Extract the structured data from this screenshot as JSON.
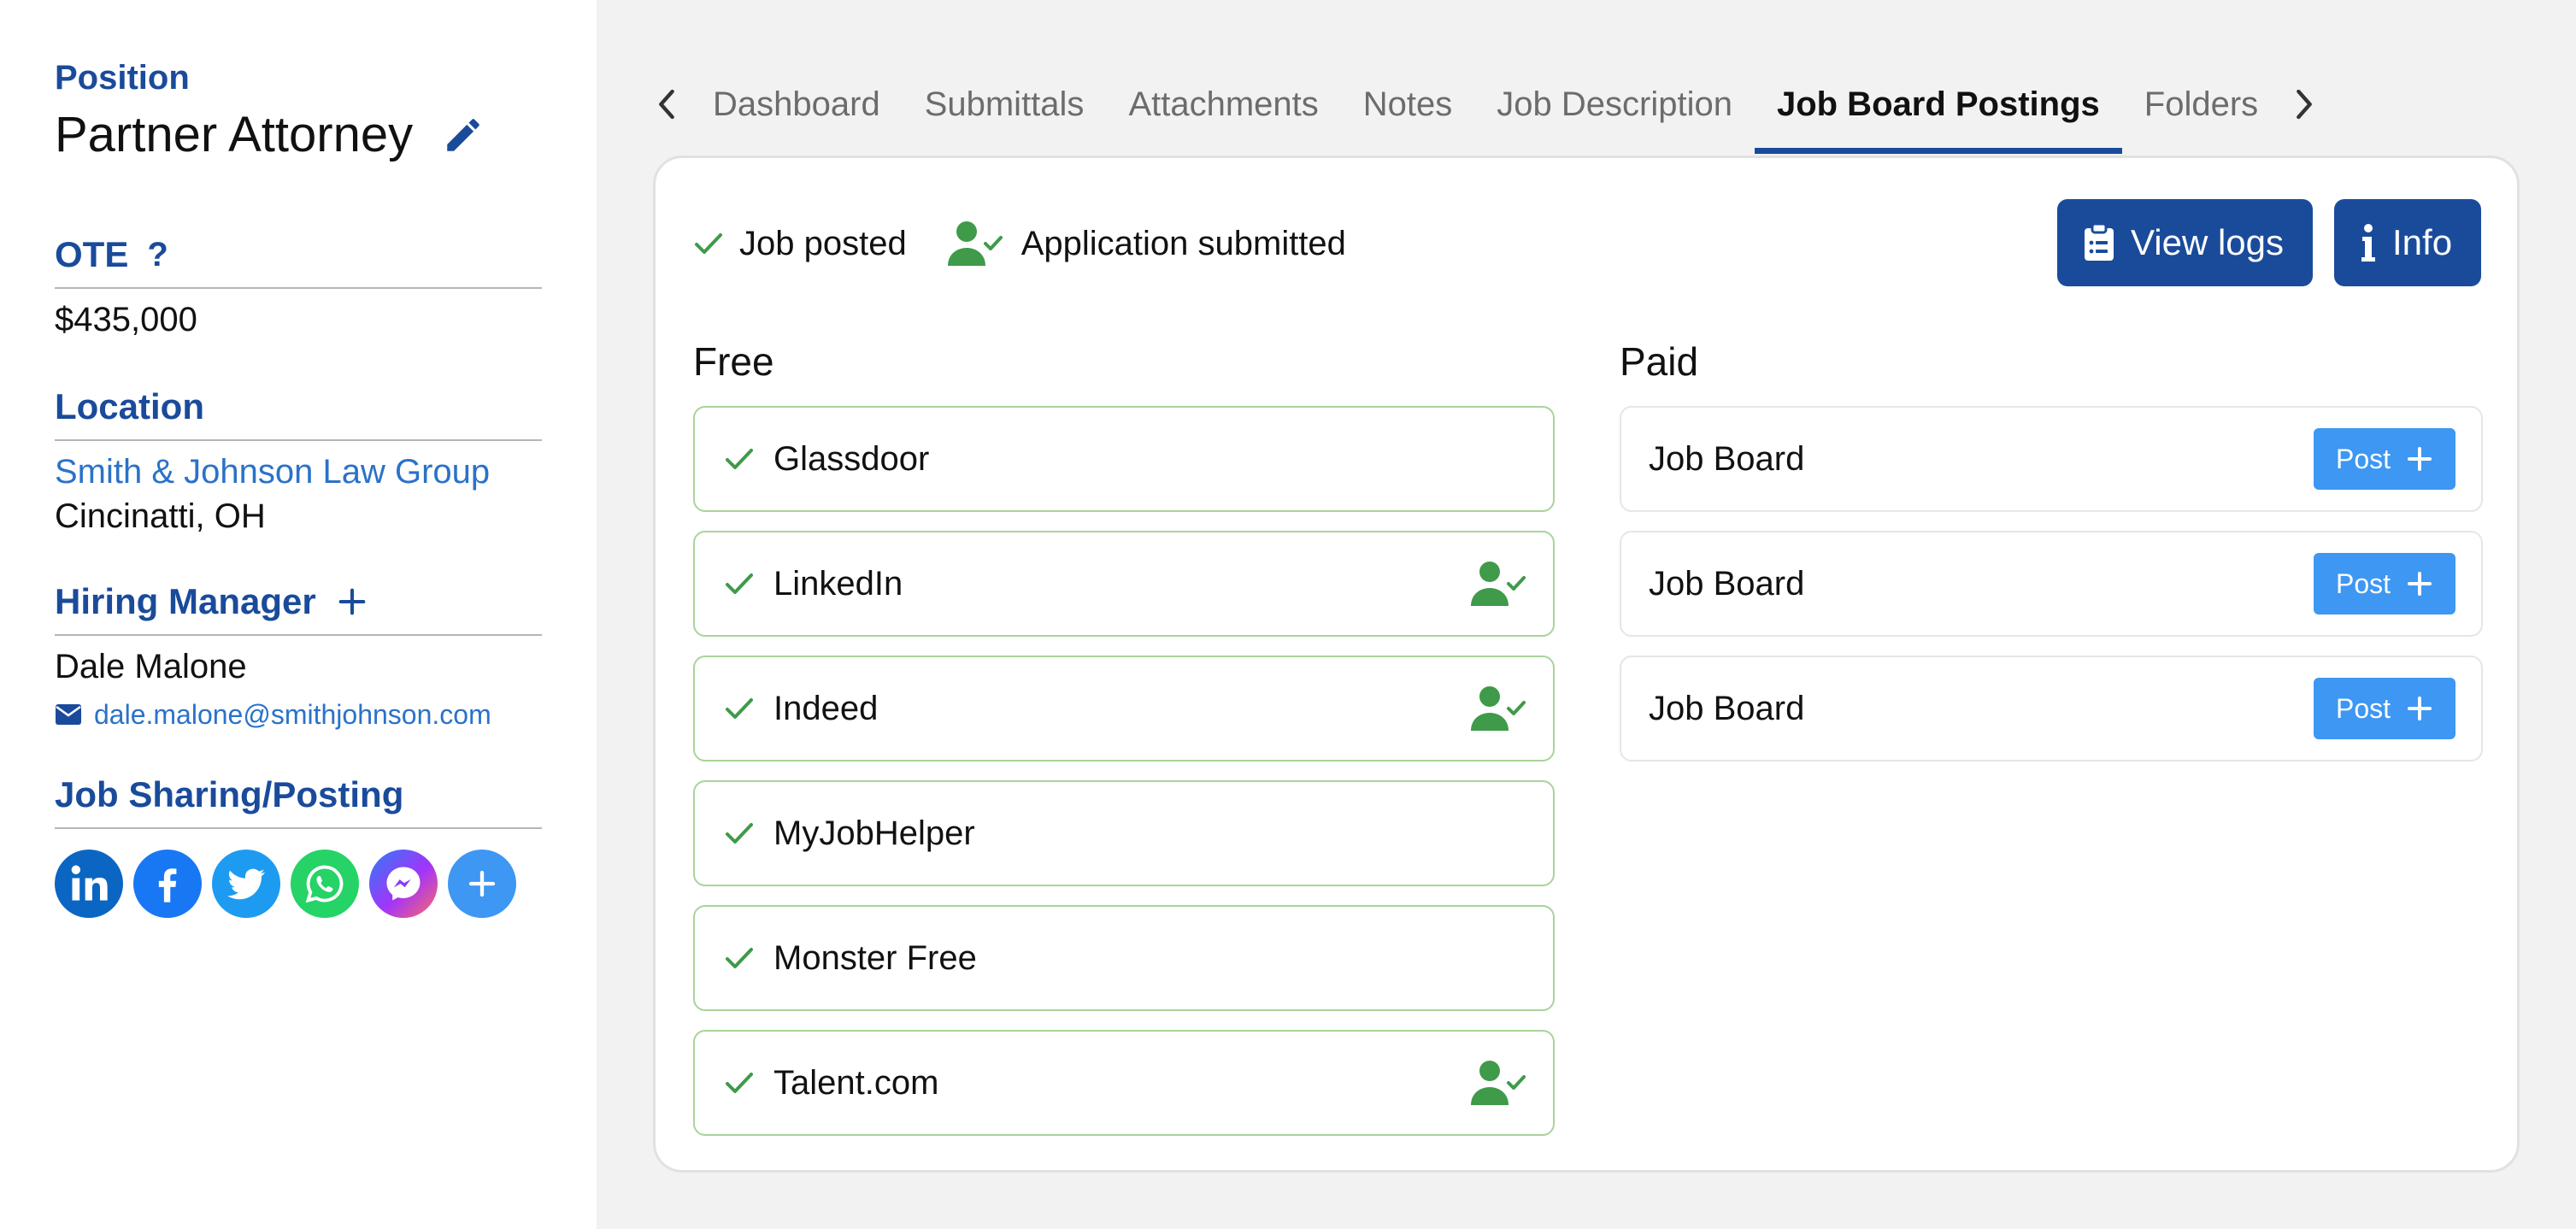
{
  "sidebar": {
    "position_label": "Position",
    "position_title": "Partner Attorney",
    "ote_label": "OTE",
    "ote_help": "?",
    "ote_value": "$435,000",
    "location_label": "Location",
    "company": "Smith & Johnson Law Group",
    "city": "Cincinatti, OH",
    "hiring_manager_label": "Hiring Manager",
    "manager_name": "Dale Malone",
    "manager_email": "dale.malone@smithjohnson.com",
    "sharing_label": "Job Sharing/Posting",
    "social": [
      "linkedin-icon",
      "facebook-icon",
      "twitter-icon",
      "whatsapp-icon",
      "messenger-icon",
      "add-share-icon"
    ]
  },
  "tabs": [
    "Dashboard",
    "Submittals",
    "Attachments",
    "Notes",
    "Job Description",
    "Job Board Postings",
    "Folders"
  ],
  "active_tab": "Job Board Postings",
  "legend": {
    "posted": "Job posted",
    "submitted": "Application submitted"
  },
  "buttons": {
    "view_logs": "View logs",
    "info": "Info"
  },
  "free": {
    "title": "Free",
    "items": [
      {
        "name": "Glassdoor",
        "applied": false
      },
      {
        "name": "LinkedIn",
        "applied": true
      },
      {
        "name": "Indeed",
        "applied": true
      },
      {
        "name": "MyJobHelper",
        "applied": false
      },
      {
        "name": "Monster Free",
        "applied": false
      },
      {
        "name": "Talent.com",
        "applied": true
      }
    ]
  },
  "paid": {
    "title": "Paid",
    "post_label": "Post",
    "items": [
      {
        "name": "Job Board"
      },
      {
        "name": "Job Board"
      },
      {
        "name": "Job Board"
      }
    ]
  },
  "colors": {
    "brand": "#1a4b9b",
    "link": "#2a72c9",
    "check_green": "#3f9a4a",
    "post_blue": "#3d97f3"
  }
}
